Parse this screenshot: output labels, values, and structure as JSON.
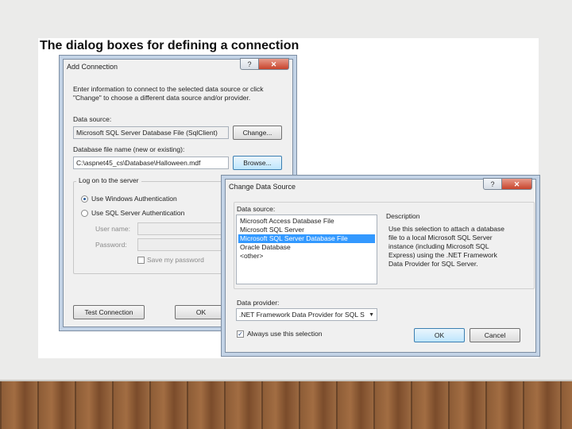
{
  "slide": {
    "title": "The dialog boxes for defining a connection"
  },
  "add_connection": {
    "title": "Add Connection",
    "help_label": "?",
    "close_label": "✕",
    "instructions_line1": "Enter information to connect to the selected data source or click",
    "instructions_line2": "\"Change\" to choose a different data source and/or provider.",
    "data_source_label": "Data source:",
    "data_source_value": "Microsoft SQL Server Database File (SqlClient)",
    "change_button": "Change...",
    "db_file_label": "Database file name (new or existing):",
    "db_file_value": "C:\\aspnet45_cs\\Database\\Halloween.mdf",
    "browse_button": "Browse...",
    "logon_label": "Log on to the server",
    "windows_auth": "Use Windows Authentication",
    "sql_auth": "Use SQL Server Authentication",
    "user_name_label": "User name:",
    "password_label": "Password:",
    "save_password": "Save my password",
    "test_button": "Test Connection",
    "ok_button": "OK"
  },
  "change_data_source": {
    "title": "Change Data Source",
    "help_label": "?",
    "close_label": "✕",
    "data_source_label": "Data source:",
    "items": [
      "Microsoft Access Database File",
      "Microsoft SQL Server",
      "Microsoft SQL Server Database File",
      "Oracle Database",
      "<other>"
    ],
    "selected_index": 2,
    "description_label": "Description",
    "description_lines": [
      "Use this selection to attach a database",
      "file to a local Microsoft SQL Server",
      "instance (including Microsoft SQL",
      "Express) using the .NET Framework",
      "Data Provider for SQL Server."
    ],
    "provider_label": "Data provider:",
    "provider_value": ".NET Framework Data Provider for SQL S",
    "always_use": "Always use this selection",
    "ok_button": "OK",
    "cancel_button": "Cancel"
  }
}
